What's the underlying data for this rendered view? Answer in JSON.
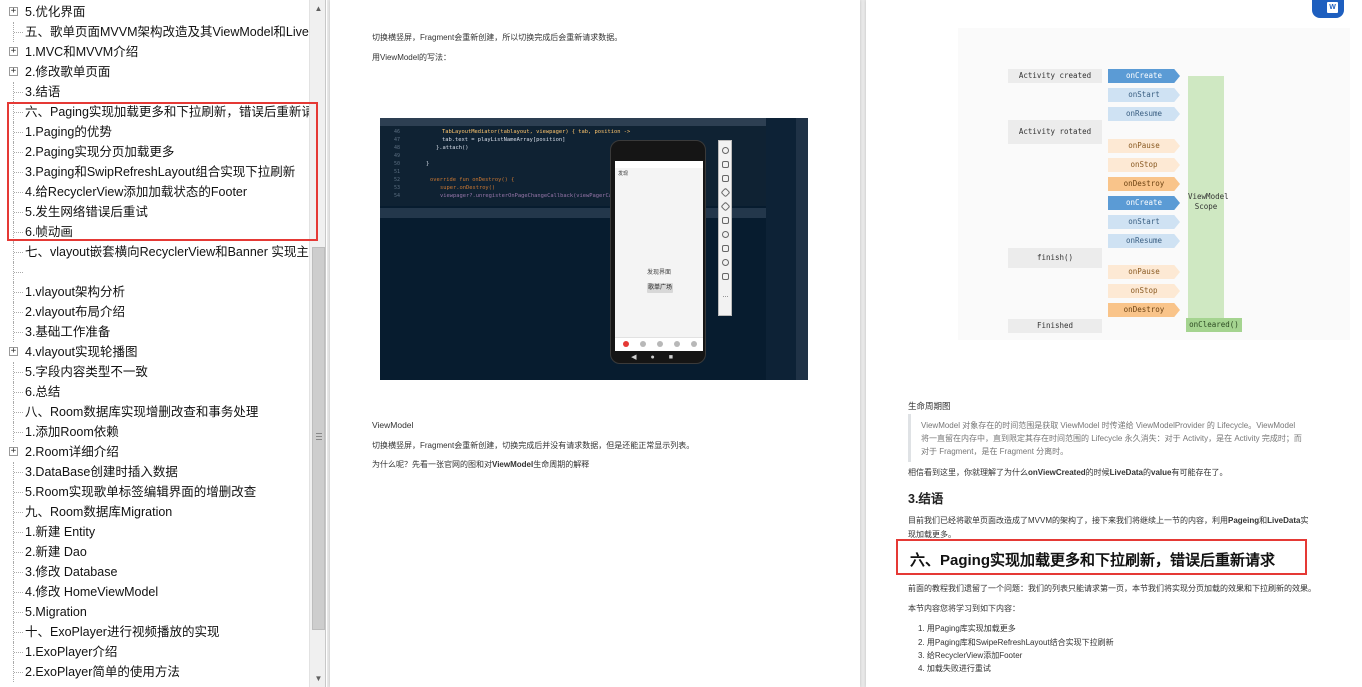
{
  "outline": {
    "items": [
      {
        "label": "5.优化界面",
        "expander": "+"
      },
      {
        "label": "五、歌单页面MVVM架构改造及其ViewModel和Live",
        "expander": ""
      },
      {
        "label": "1.MVC和MVVM介绍",
        "expander": "+"
      },
      {
        "label": "2.修改歌单页面",
        "expander": "+"
      },
      {
        "label": "3.结语",
        "expander": ""
      },
      {
        "label": "六、Paging实现加载更多和下拉刷新，错误后重新请",
        "expander": ""
      },
      {
        "label": "1.Paging的优势",
        "expander": ""
      },
      {
        "label": "2.Paging实现分页加载更多",
        "expander": ""
      },
      {
        "label": "3.Paging和SwipRefreshLayout组合实现下拉刷新",
        "expander": ""
      },
      {
        "label": "4.给RecyclerView添加加载状态的Footer",
        "expander": ""
      },
      {
        "label": "5.发生网络错误后重试",
        "expander": ""
      },
      {
        "label": "6.帧动画",
        "expander": ""
      },
      {
        "label": "七、vlayout嵌套横向RecyclerView和Banner 实现主",
        "expander": ""
      },
      {
        "label": "",
        "expander": ""
      },
      {
        "label": "1.vlayout架构分析",
        "expander": ""
      },
      {
        "label": "2.vlayout布局介绍",
        "expander": ""
      },
      {
        "label": "3.基础工作准备",
        "expander": ""
      },
      {
        "label": "4.vlayout实现轮播图",
        "expander": "+"
      },
      {
        "label": "5.字段内容类型不一致",
        "expander": ""
      },
      {
        "label": "6.总结",
        "expander": ""
      },
      {
        "label": "八、Room数据库实现增删改查和事务处理",
        "expander": ""
      },
      {
        "label": "1.添加Room依赖",
        "expander": ""
      },
      {
        "label": "2.Room详细介绍",
        "expander": "+"
      },
      {
        "label": "3.DataBase创建时插入数据",
        "expander": ""
      },
      {
        "label": "5.Room实现歌单标签编辑界面的增删改查",
        "expander": ""
      },
      {
        "label": "九、Room数据库Migration",
        "expander": ""
      },
      {
        "label": "1.新建 Entity",
        "expander": ""
      },
      {
        "label": "2.新建 Dao",
        "expander": ""
      },
      {
        "label": "3.修改 Database",
        "expander": ""
      },
      {
        "label": "4.修改 HomeViewModel",
        "expander": ""
      },
      {
        "label": "5.Migration",
        "expander": ""
      },
      {
        "label": "十、ExoPlayer进行视频播放的实现",
        "expander": ""
      },
      {
        "label": "1.ExoPlayer介绍",
        "expander": ""
      },
      {
        "label": "2.ExoPlayer简单的使用方法",
        "expander": ""
      }
    ]
  },
  "page1": {
    "line1": "切换横竖屏，Fragment会重新创建，所以切换完成后会重新请求数据。",
    "line2": "用ViewModel的写法：",
    "code": [
      "TabLayoutMediator(tablayout, viewpager) { tab, position ->",
      "    tab.text = playListNameArray[position]",
      "}.attach()",
      "",
      "}",
      "",
      "override fun onDestroy() {",
      "    super.onDestroy()",
      "    viewpager?.unregisterOnPageChangeCallback(viewPagerCall"
    ],
    "phone_title": "发现",
    "phone_found": "发现界面",
    "phone_button": "歌单广场",
    "sub_title": "ViewModel",
    "body1": "切换横竖屏，Fragment会重新创建，切换完成后并没有请求数据，但是还能正常显示列表。",
    "body2_pre": "为什么呢？先看一张官网的图和对",
    "body2_bold": "ViewModel",
    "body2_post": "生命周期的解释"
  },
  "diagram": {
    "activity_created": "Activity created",
    "activity_rotated": "Activity rotated",
    "finish": "finish()",
    "finished": "Finished",
    "oncreate": "onCreate",
    "onstart": "onStart",
    "onresume": "onResume",
    "onpause": "onPause",
    "onstop": "onStop",
    "ondestroy": "onDestroy",
    "vm_scope_1": "ViewModel",
    "vm_scope_2": "Scope",
    "oncleared": "onCleared()"
  },
  "page2": {
    "caption": "生命周期图",
    "quote1": "ViewModel 对象存在的时间范围是获取 ViewModel 时传递给 ViewModelProvider 的 Lifecycle。ViewModel",
    "quote2": "将一直留在内存中，直到限定其存在时间范围的 Lifecycle 永久消失：对于 Activity，是在 Activity 完成时；而",
    "quote3": "对于 Fragment，是在 Fragment 分离时。",
    "conclusion_pre": "相信看到这里，你就理解了为什么",
    "conclusion_b1": "onViewCreated",
    "conclusion_mid": "的时候",
    "conclusion_b2": "LiveData",
    "conclusion_mid2": "的",
    "conclusion_b3": "value",
    "conclusion_post": "有可能存在了。",
    "h3": "3.结语",
    "summary1_pre": "目前我们已经将歌单页面改造成了MVVM的架构了，接下来我们将继续上一节的内容，利用",
    "summary1_b1": "Pageing",
    "summary1_mid": "和",
    "summary1_b2": "LiveData",
    "summary1_post": "实",
    "summary2": "现加载更多。",
    "h2": "六、Paging实现加载更多和下拉刷新，错误后重新请求",
    "intro1": "前面的教程我们遗留了一个问题：我们的列表只能请求第一页，本节我们将实现分页加载的效果和下拉刷新的效果。",
    "intro2": "本节内容您将学习到如下内容：",
    "list": [
      "1. 用Paging库实现加载更多",
      "2. 用Paging库和SwipeRefreshLayout结合实现下拉刷新",
      "3. 给RecyclerView添加Footer",
      "4. 加载失败进行重试"
    ],
    "word_icon": "W"
  },
  "colors": {
    "highlight": "#e53935",
    "ide_bg": "#071c2f",
    "blue": "#5b9bd5",
    "orange": "#f9c48a",
    "green": "#cfe8c2"
  }
}
